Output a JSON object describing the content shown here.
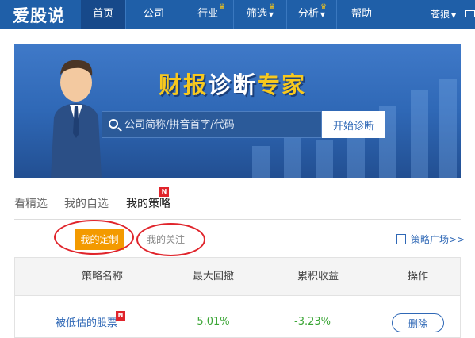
{
  "nav": {
    "logo": "爱股说",
    "items": [
      {
        "label": "首页",
        "active": true,
        "premium": false,
        "dropdown": false
      },
      {
        "label": "公司",
        "active": false,
        "premium": false,
        "dropdown": false
      },
      {
        "label": "行业",
        "active": false,
        "premium": true,
        "dropdown": false
      },
      {
        "label": "筛选",
        "active": false,
        "premium": true,
        "dropdown": true
      },
      {
        "label": "分析",
        "active": false,
        "premium": true,
        "dropdown": true
      },
      {
        "label": "帮助",
        "active": false,
        "premium": false,
        "dropdown": false
      }
    ],
    "user": "苍狼"
  },
  "banner": {
    "title_part1": "财报",
    "title_part2": "诊断",
    "title_part3": "专家",
    "search_placeholder": "公司简称/拼音首字/代码",
    "start_button": "开始诊断"
  },
  "tabs": [
    {
      "label": "看精选",
      "active": false
    },
    {
      "label": "我的自选",
      "active": false
    },
    {
      "label": "我的策略",
      "active": true,
      "badge": "N"
    }
  ],
  "subtabs": [
    {
      "label": "我的定制",
      "active": true
    },
    {
      "label": "我的关注",
      "active": false
    }
  ],
  "plaza_link": "策略广场>>",
  "table": {
    "headers": [
      "策略名称",
      "最大回撤",
      "累积收益",
      "操作"
    ],
    "rows": [
      {
        "name": "被低估的股票",
        "badge": "N",
        "max_drawdown": "5.01%",
        "cumulative_return": "-3.23%",
        "action": "删除"
      }
    ]
  },
  "colors": {
    "nav": "#1f5fa8",
    "accent": "#f39a00",
    "link": "#2f68b6",
    "positive": "#3aa535",
    "badge": "#e0242b"
  }
}
